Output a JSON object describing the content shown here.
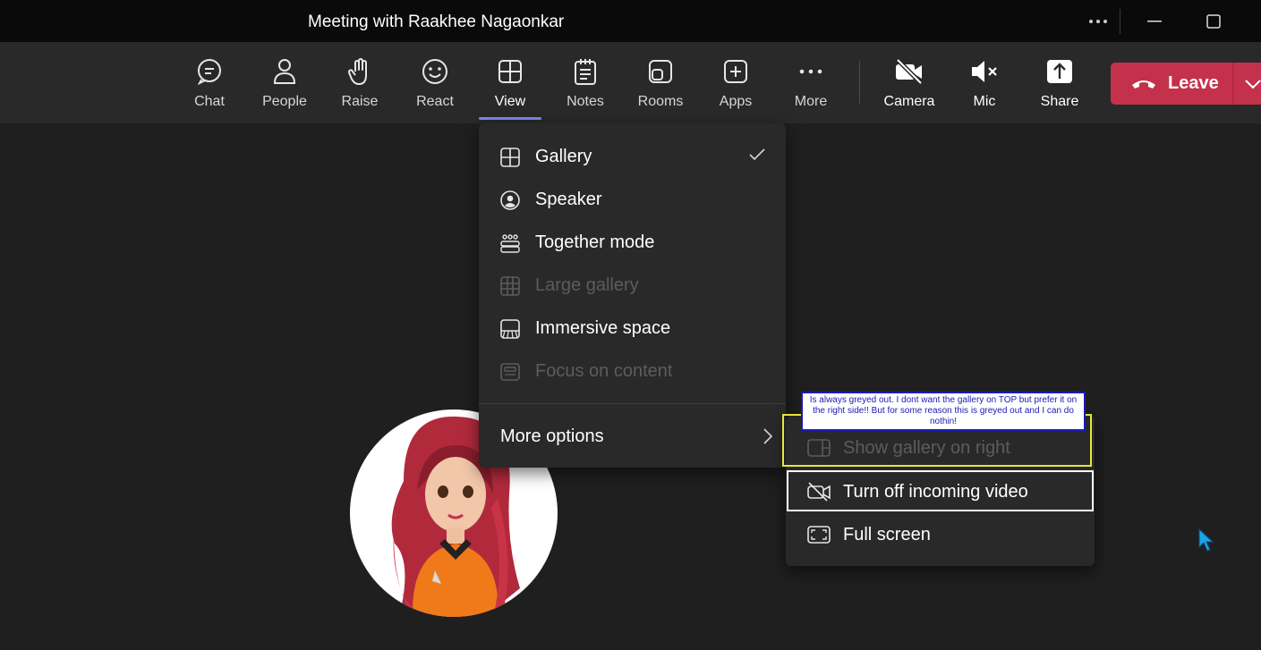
{
  "window": {
    "title": "Meeting with Raakhee Nagaonkar"
  },
  "toolbar": {
    "items": [
      {
        "label": "Chat",
        "icon": "chat-icon"
      },
      {
        "label": "People",
        "icon": "people-icon"
      },
      {
        "label": "Raise",
        "icon": "raise-hand-icon"
      },
      {
        "label": "React",
        "icon": "react-smiley-icon"
      },
      {
        "label": "View",
        "icon": "view-grid-icon",
        "active": true
      },
      {
        "label": "Notes",
        "icon": "notes-icon"
      },
      {
        "label": "Rooms",
        "icon": "rooms-icon"
      },
      {
        "label": "Apps",
        "icon": "apps-plus-icon"
      },
      {
        "label": "More",
        "icon": "more-ellipsis-icon"
      }
    ],
    "media": [
      {
        "label": "Camera",
        "icon": "camera-off-icon"
      },
      {
        "label": "Mic",
        "icon": "mic-muted-icon"
      },
      {
        "label": "Share",
        "icon": "share-icon"
      }
    ],
    "leave_label": "Leave"
  },
  "view_menu": {
    "items": [
      {
        "label": "Gallery",
        "icon": "gallery-icon",
        "checked": true,
        "disabled": false
      },
      {
        "label": "Speaker",
        "icon": "speaker-icon",
        "disabled": false
      },
      {
        "label": "Together mode",
        "icon": "together-mode-icon",
        "disabled": false
      },
      {
        "label": "Large gallery",
        "icon": "large-gallery-icon",
        "disabled": true
      },
      {
        "label": "Immersive space",
        "icon": "immersive-space-icon",
        "disabled": false
      },
      {
        "label": "Focus on content",
        "icon": "focus-content-icon",
        "disabled": true
      }
    ],
    "more_options_label": "More options"
  },
  "more_options_menu": {
    "items": [
      {
        "label": "Show gallery on right",
        "icon": "gallery-right-icon",
        "disabled": true
      },
      {
        "label": "Turn off incoming video",
        "icon": "video-off-icon",
        "disabled": false
      },
      {
        "label": "Full screen",
        "icon": "full-screen-icon",
        "disabled": false
      }
    ]
  },
  "annotation": {
    "text": "Is always greyed out. I dont want the gallery on TOP but prefer it on the right side!! But for some reason this is greyed out and I can do nothin!",
    "border_color": "#1a1ab8"
  },
  "colors": {
    "accent": "#7f85f5",
    "leave": "#c4314b",
    "highlight_yellow": "#e9e43d",
    "cursor": "#1aa3e8"
  }
}
